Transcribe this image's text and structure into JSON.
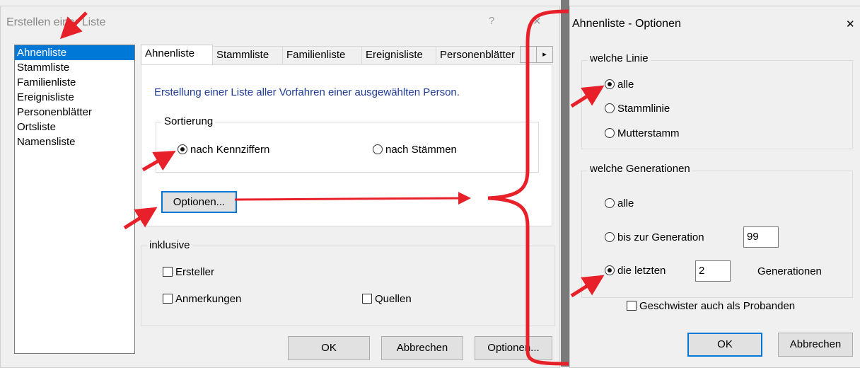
{
  "left_dialog": {
    "title": "Erstellen einer Liste",
    "help_glyph": "?",
    "close_glyph": "✕",
    "list_items": [
      "Ahnenliste",
      "Stammliste",
      "Familienliste",
      "Ereignisliste",
      "Personenblätter",
      "Ortsliste",
      "Namensliste"
    ],
    "selected_index": 0,
    "tabs": [
      "Ahnenliste",
      "Stammliste",
      "Familienliste",
      "Ereignisliste",
      "Personenblätter"
    ],
    "tab_scroll_glyph": "▸",
    "description": "Erstellung einer Liste aller Vorfahren einer ausgewählten Person.",
    "sortierung": {
      "label": "Sortierung",
      "option1": "nach Kennziffern",
      "option2": "nach Stämmen",
      "selected": "option1"
    },
    "optionen_inner": "Optionen...",
    "inklusive": {
      "label": "inklusive",
      "ersteller": "Ersteller",
      "anmerkungen": "Anmerkungen",
      "quellen": "Quellen"
    },
    "ok": "OK",
    "abbrechen": "Abbrechen",
    "optionen": "Optionen..."
  },
  "right_dialog": {
    "title": "Ahnenliste - Optionen",
    "close_glyph": "✕",
    "linie": {
      "label": "welche Linie",
      "alle": "alle",
      "stammlinie": "Stammlinie",
      "mutterstamm": "Mutterstamm",
      "selected": "alle"
    },
    "generationen": {
      "label": "welche Generationen",
      "alle": "alle",
      "bis": "bis zur Generation",
      "bis_value": "99",
      "letzten": "die letzten",
      "letzten_value": "2",
      "suffix": "Generationen",
      "selected": "letzten"
    },
    "geschwister": "Geschwister auch als Probanden",
    "ok": "OK",
    "abbrechen": "Abbrechen"
  },
  "annotation_color": "#e8202a"
}
